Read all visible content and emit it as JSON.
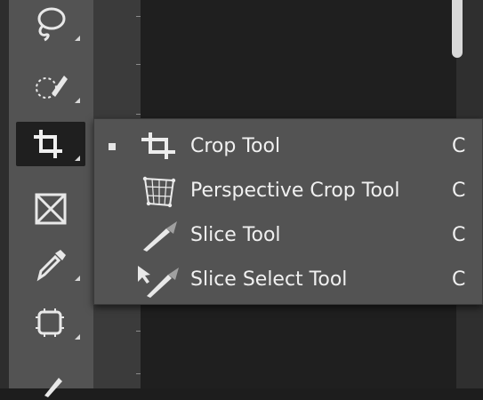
{
  "toolbar": {
    "tools": [
      {
        "icon": "lasso-icon"
      },
      {
        "icon": "quick-selection-icon"
      },
      {
        "icon": "crop-icon",
        "active": true
      },
      {
        "icon": "frame-icon"
      },
      {
        "icon": "eyedropper-icon"
      },
      {
        "icon": "spot-healing-icon"
      },
      {
        "icon": "brush-icon"
      }
    ]
  },
  "flyout": {
    "items": [
      {
        "label": "Crop Tool",
        "shortcut": "C",
        "icon": "crop-icon",
        "selected": true
      },
      {
        "label": "Perspective Crop Tool",
        "shortcut": "C",
        "icon": "perspective-crop-icon"
      },
      {
        "label": "Slice Tool",
        "shortcut": "C",
        "icon": "slice-icon"
      },
      {
        "label": "Slice Select Tool",
        "shortcut": "C",
        "icon": "slice-select-icon"
      }
    ]
  },
  "colors": {
    "toolbar_bg": "#535353",
    "canvas_bg": "#1f1f1f",
    "text": "#f0f0f0"
  }
}
